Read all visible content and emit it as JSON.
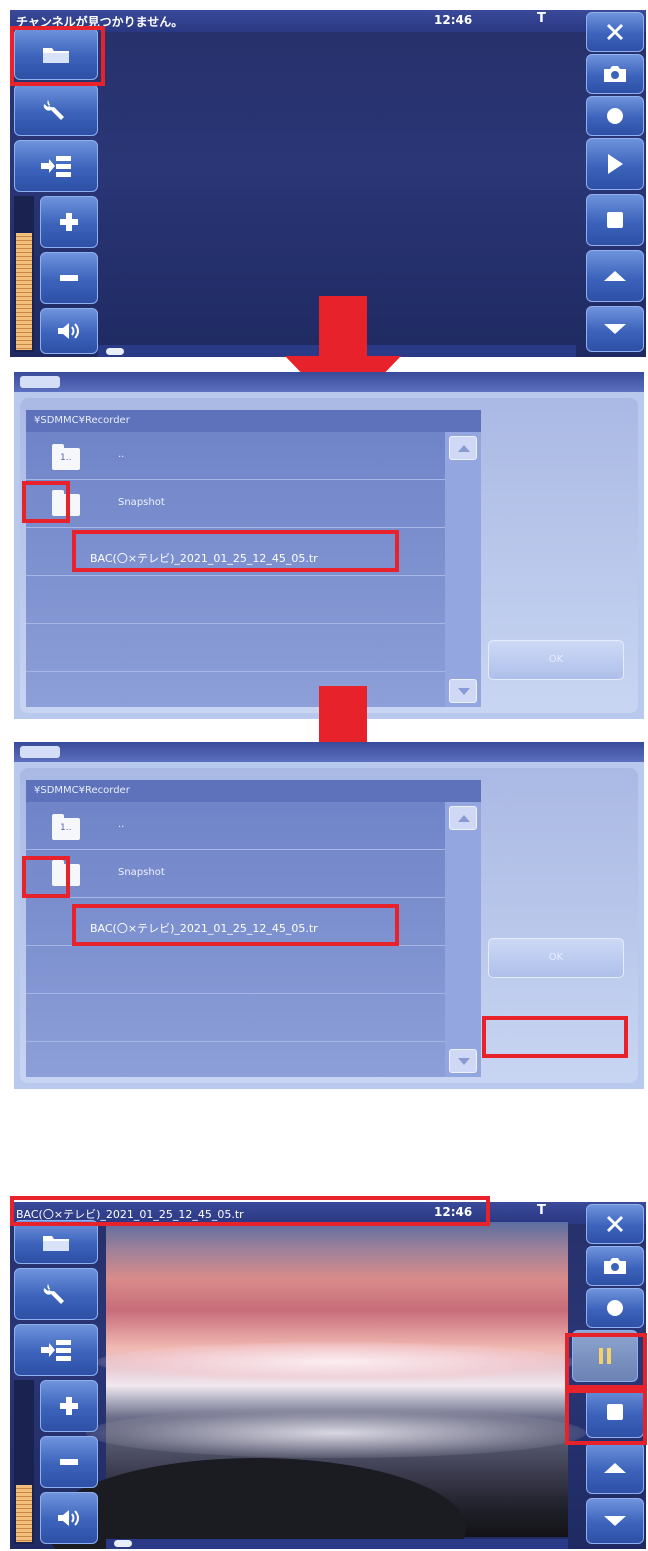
{
  "panel1": {
    "status_text": "チャンネルが見つかりません。",
    "time": "12:46",
    "signal": "T",
    "left_buttons": [
      "folder-icon",
      "wrench-icon",
      "list-icon",
      "plus-icon",
      "minus-icon",
      "speaker-icon"
    ],
    "right_buttons": [
      "close-icon",
      "camera-icon",
      "record-icon",
      "play-icon",
      "stop-icon",
      "up-icon",
      "down-icon"
    ],
    "volume_level": 0.75
  },
  "browser": {
    "path": "¥SDMMC¥Recorder",
    "up_label": "..",
    "up_icon_text": "1..",
    "folder_label": "Snapshot",
    "file_label": "BAC(〇×テレビ)_2021_01_25_12_45_05.tr",
    "ok_label": "OK"
  },
  "panel4": {
    "status_text": "BAC(〇×テレビ)_2021_01_25_12_45_05.tr",
    "time": "12:46",
    "signal": "T",
    "left_buttons": [
      "folder-icon",
      "wrench-icon",
      "list-icon",
      "plus-icon",
      "minus-icon",
      "speaker-icon"
    ],
    "right_buttons": [
      "close-icon",
      "camera-icon",
      "record-icon",
      "pause-icon",
      "stop-icon",
      "up-icon",
      "down-icon"
    ],
    "volume_level": 0.35
  },
  "colors": {
    "highlight": "#e8222a",
    "button": "#3c63bb",
    "screen": "#26306a"
  }
}
